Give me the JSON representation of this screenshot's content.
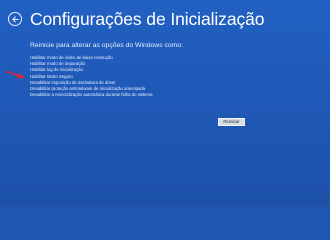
{
  "header": {
    "title": "Configurações de Inicialização",
    "back_icon": "back-arrow-icon"
  },
  "main": {
    "subtitle": "Reinicie para alterar as opções do Windows como:",
    "options": [
      "Habilitar modo de vídeo de baixa resolução",
      "Habilitar modo de depuração",
      "Habilitar log de inicialização",
      "Habilitar Modo Seguro",
      "Desabilitar imposição de assinatura de driver",
      "Desabilitar proteção antimalware de inicialização antecipada",
      "Desabilitar a reinicialização automática durante falha do sistema"
    ],
    "restart_label": "Reiniciar"
  },
  "annotation": {
    "icon": "red-arrow-icon",
    "color": "#e8222a",
    "points_to_option": "Habilitar Modo Seguro"
  },
  "colors": {
    "background": "#1f57b0",
    "text": "#ffffff"
  }
}
